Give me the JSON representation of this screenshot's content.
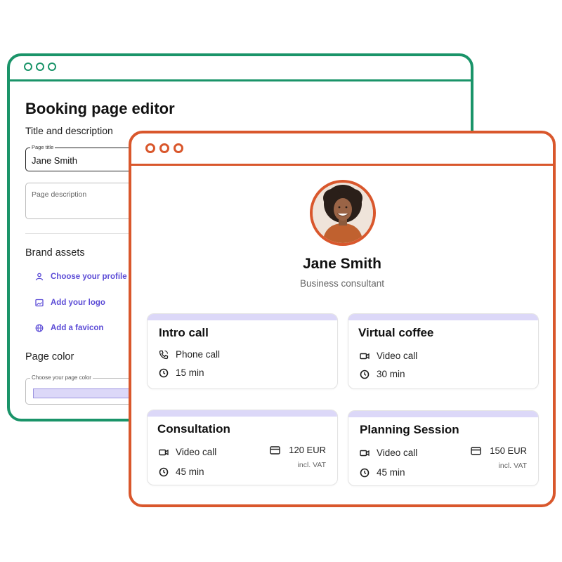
{
  "editor": {
    "title": "Booking page editor",
    "subtitle": "Title and description",
    "page_title_label": "Page title",
    "page_title_value": "Jane Smith",
    "page_description_placeholder": "Page description",
    "brand_assets_heading": "Brand assets",
    "brand_items": [
      {
        "icon": "user-icon",
        "label": "Choose your profile p"
      },
      {
        "icon": "image-icon",
        "label": "Add your logo"
      },
      {
        "icon": "globe-icon",
        "label": "Add a favicon"
      }
    ],
    "page_color_heading": "Page color",
    "page_color_label": "Choose your page color"
  },
  "booking": {
    "name": "Jane Smith",
    "role": "Business consultant",
    "cards": [
      {
        "title": "Intro call",
        "type": "Phone call",
        "type_icon": "phone-icon",
        "duration": "15 min"
      },
      {
        "title": "Virtual coffee",
        "type": "Video call",
        "type_icon": "video-icon",
        "duration": "30 min"
      },
      {
        "title": "Consultation",
        "type": "Video call",
        "type_icon": "video-icon",
        "duration": "45 min",
        "price": "120 EUR",
        "vat": "incl. VAT"
      },
      {
        "title": "Planning Session",
        "type": "Video call",
        "type_icon": "video-icon",
        "duration": "45 min",
        "price": "150 EUR",
        "vat": "incl. VAT"
      }
    ]
  },
  "colors": {
    "editor_accent": "#1a9469",
    "booking_accent": "#d9572c",
    "link_purple": "#5b4bd6",
    "card_top": "#dcd8f8"
  }
}
